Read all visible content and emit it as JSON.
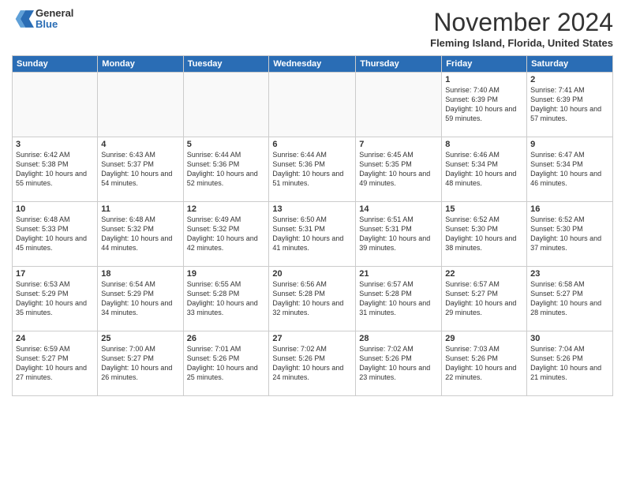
{
  "logo": {
    "general": "General",
    "blue": "Blue"
  },
  "title": "November 2024",
  "location": "Fleming Island, Florida, United States",
  "days_of_week": [
    "Sunday",
    "Monday",
    "Tuesday",
    "Wednesday",
    "Thursday",
    "Friday",
    "Saturday"
  ],
  "weeks": [
    [
      {
        "day": "",
        "info": ""
      },
      {
        "day": "",
        "info": ""
      },
      {
        "day": "",
        "info": ""
      },
      {
        "day": "",
        "info": ""
      },
      {
        "day": "",
        "info": ""
      },
      {
        "day": "1",
        "info": "Sunrise: 7:40 AM\nSunset: 6:39 PM\nDaylight: 10 hours and 59 minutes."
      },
      {
        "day": "2",
        "info": "Sunrise: 7:41 AM\nSunset: 6:39 PM\nDaylight: 10 hours and 57 minutes."
      }
    ],
    [
      {
        "day": "3",
        "info": "Sunrise: 6:42 AM\nSunset: 5:38 PM\nDaylight: 10 hours and 55 minutes."
      },
      {
        "day": "4",
        "info": "Sunrise: 6:43 AM\nSunset: 5:37 PM\nDaylight: 10 hours and 54 minutes."
      },
      {
        "day": "5",
        "info": "Sunrise: 6:44 AM\nSunset: 5:36 PM\nDaylight: 10 hours and 52 minutes."
      },
      {
        "day": "6",
        "info": "Sunrise: 6:44 AM\nSunset: 5:36 PM\nDaylight: 10 hours and 51 minutes."
      },
      {
        "day": "7",
        "info": "Sunrise: 6:45 AM\nSunset: 5:35 PM\nDaylight: 10 hours and 49 minutes."
      },
      {
        "day": "8",
        "info": "Sunrise: 6:46 AM\nSunset: 5:34 PM\nDaylight: 10 hours and 48 minutes."
      },
      {
        "day": "9",
        "info": "Sunrise: 6:47 AM\nSunset: 5:34 PM\nDaylight: 10 hours and 46 minutes."
      }
    ],
    [
      {
        "day": "10",
        "info": "Sunrise: 6:48 AM\nSunset: 5:33 PM\nDaylight: 10 hours and 45 minutes."
      },
      {
        "day": "11",
        "info": "Sunrise: 6:48 AM\nSunset: 5:32 PM\nDaylight: 10 hours and 44 minutes."
      },
      {
        "day": "12",
        "info": "Sunrise: 6:49 AM\nSunset: 5:32 PM\nDaylight: 10 hours and 42 minutes."
      },
      {
        "day": "13",
        "info": "Sunrise: 6:50 AM\nSunset: 5:31 PM\nDaylight: 10 hours and 41 minutes."
      },
      {
        "day": "14",
        "info": "Sunrise: 6:51 AM\nSunset: 5:31 PM\nDaylight: 10 hours and 39 minutes."
      },
      {
        "day": "15",
        "info": "Sunrise: 6:52 AM\nSunset: 5:30 PM\nDaylight: 10 hours and 38 minutes."
      },
      {
        "day": "16",
        "info": "Sunrise: 6:52 AM\nSunset: 5:30 PM\nDaylight: 10 hours and 37 minutes."
      }
    ],
    [
      {
        "day": "17",
        "info": "Sunrise: 6:53 AM\nSunset: 5:29 PM\nDaylight: 10 hours and 35 minutes."
      },
      {
        "day": "18",
        "info": "Sunrise: 6:54 AM\nSunset: 5:29 PM\nDaylight: 10 hours and 34 minutes."
      },
      {
        "day": "19",
        "info": "Sunrise: 6:55 AM\nSunset: 5:28 PM\nDaylight: 10 hours and 33 minutes."
      },
      {
        "day": "20",
        "info": "Sunrise: 6:56 AM\nSunset: 5:28 PM\nDaylight: 10 hours and 32 minutes."
      },
      {
        "day": "21",
        "info": "Sunrise: 6:57 AM\nSunset: 5:28 PM\nDaylight: 10 hours and 31 minutes."
      },
      {
        "day": "22",
        "info": "Sunrise: 6:57 AM\nSunset: 5:27 PM\nDaylight: 10 hours and 29 minutes."
      },
      {
        "day": "23",
        "info": "Sunrise: 6:58 AM\nSunset: 5:27 PM\nDaylight: 10 hours and 28 minutes."
      }
    ],
    [
      {
        "day": "24",
        "info": "Sunrise: 6:59 AM\nSunset: 5:27 PM\nDaylight: 10 hours and 27 minutes."
      },
      {
        "day": "25",
        "info": "Sunrise: 7:00 AM\nSunset: 5:27 PM\nDaylight: 10 hours and 26 minutes."
      },
      {
        "day": "26",
        "info": "Sunrise: 7:01 AM\nSunset: 5:26 PM\nDaylight: 10 hours and 25 minutes."
      },
      {
        "day": "27",
        "info": "Sunrise: 7:02 AM\nSunset: 5:26 PM\nDaylight: 10 hours and 24 minutes."
      },
      {
        "day": "28",
        "info": "Sunrise: 7:02 AM\nSunset: 5:26 PM\nDaylight: 10 hours and 23 minutes."
      },
      {
        "day": "29",
        "info": "Sunrise: 7:03 AM\nSunset: 5:26 PM\nDaylight: 10 hours and 22 minutes."
      },
      {
        "day": "30",
        "info": "Sunrise: 7:04 AM\nSunset: 5:26 PM\nDaylight: 10 hours and 21 minutes."
      }
    ]
  ]
}
